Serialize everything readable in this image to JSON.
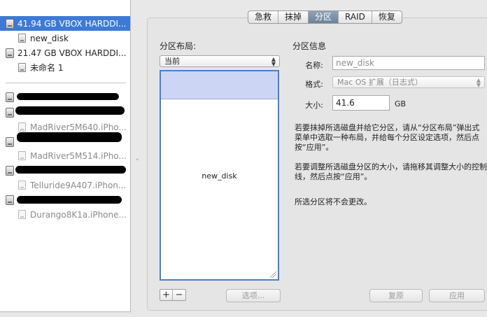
{
  "sidebar": {
    "disks": [
      {
        "label": "41.94 GB VBOX HARDDI...",
        "selected": true
      },
      {
        "label": "new_disk"
      },
      {
        "label": "21.47 GB VBOX HARDDI..."
      },
      {
        "label": "未命名 1"
      }
    ],
    "hidden_devices": [
      {
        "label": "MadRiver5M640.iPho..."
      },
      {
        "label": "MadRiver5M514.iPho..."
      },
      {
        "label": "Telluride9A407.iPhon..."
      },
      {
        "label": "Durango8K1a.iPhone..."
      }
    ]
  },
  "tabs": [
    {
      "label": "急救"
    },
    {
      "label": "抹掉"
    },
    {
      "label": "分区",
      "active": true
    },
    {
      "label": "RAID"
    },
    {
      "label": "恢复"
    }
  ],
  "layout": {
    "title": "分区布局:",
    "scheme_value": "当前",
    "partition_label": "new_disk",
    "add_label": "+",
    "remove_label": "−",
    "options_label": "选项..."
  },
  "info": {
    "title": "分区信息",
    "name_label": "名称:",
    "name_value": "new_disk",
    "format_label": "格式:",
    "format_value": "Mac OS 扩展（日志式）",
    "size_label": "大小:",
    "size_value": "41.6",
    "size_unit": "GB",
    "help_1": "若要抹掉所选磁盘并给它分区，请从“分区布局”弹出式菜单中选取一种布局，并给每个分区设定选项，然后点按“应用”。",
    "help_2": "若要调整所选磁盘分区的大小，请拖移其调整大小的控制线，然后点按“应用”。",
    "help_3": "所选分区将不会更改。",
    "revert_label": "复原",
    "apply_label": "应用"
  }
}
